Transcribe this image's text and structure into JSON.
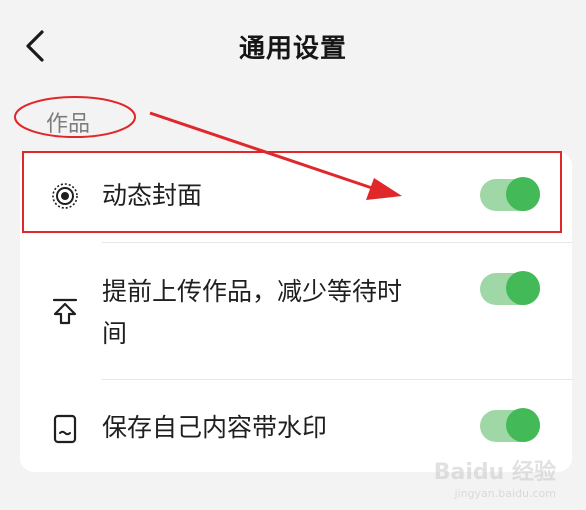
{
  "header": {
    "title": "通用设置",
    "back_icon": "chevron-left-icon"
  },
  "section": {
    "label": "作品"
  },
  "settings": [
    {
      "icon": "live-cover-icon",
      "label_lines": [
        "动态封面"
      ],
      "enabled": true
    },
    {
      "icon": "upload-arrow-icon",
      "label_lines": [
        "提前上传作品，减少等待时",
        "间"
      ],
      "enabled": true
    },
    {
      "icon": "watermark-save-icon",
      "label_lines": [
        "保存自己内容带水印"
      ],
      "enabled": true
    }
  ],
  "colors": {
    "toggle_track": "#9fd7a6",
    "toggle_knob": "#43b957",
    "annotation": "#e0272a"
  },
  "watermark": {
    "brand": "Baidu 经验",
    "url": "jingyan.baidu.com"
  }
}
